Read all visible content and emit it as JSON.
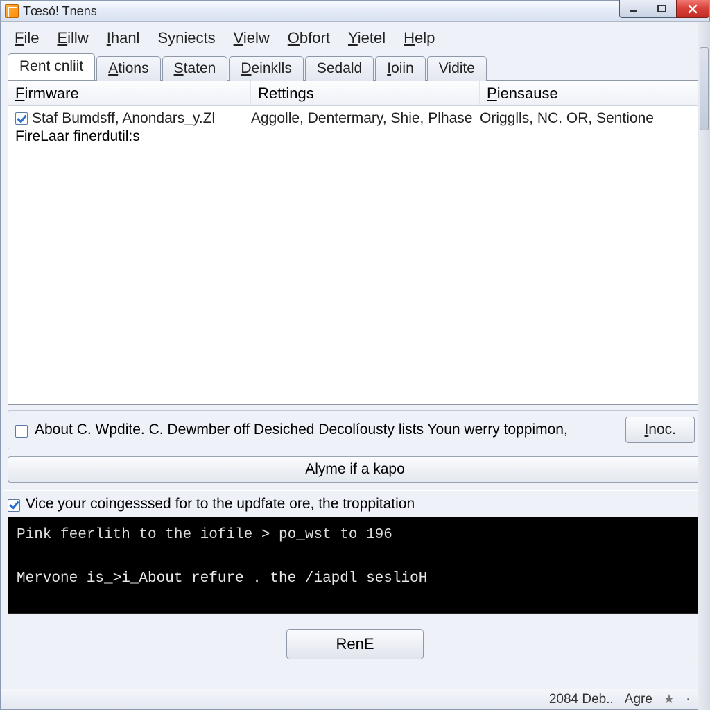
{
  "window": {
    "title": "Tœsó! Tnens"
  },
  "menu": {
    "items": [
      {
        "label": "File",
        "mn": "F",
        "rest": "ile"
      },
      {
        "label": "Eillw",
        "mn": "E",
        "rest": "illw"
      },
      {
        "label": "Ihanl",
        "mn": "I",
        "rest": "hanl"
      },
      {
        "label": "Syniects",
        "mn": "",
        "rest": "Syniects"
      },
      {
        "label": "Vielw",
        "mn": "V",
        "rest": "ielw"
      },
      {
        "label": "Obfort",
        "mn": "O",
        "rest": "bfort"
      },
      {
        "label": "Yietel",
        "mn": "Y",
        "rest": "ietel"
      },
      {
        "label": "Help",
        "mn": "H",
        "rest": "elp"
      }
    ]
  },
  "tabs": [
    {
      "label": "Rent cnliit",
      "active": true
    },
    {
      "label": "Ations",
      "mn": "A",
      "rest": "tions"
    },
    {
      "label": "Staten",
      "mn": "S",
      "rest": "taten"
    },
    {
      "label": "Deinklls",
      "mn": "D",
      "rest": "einklls"
    },
    {
      "label": "Sedald"
    },
    {
      "label": "Ioiin",
      "mn": "I",
      "rest": "oiin"
    },
    {
      "label": "Vidite"
    }
  ],
  "columns": {
    "c1": {
      "mn": "F",
      "rest": "irmware"
    },
    "c2": {
      "label": "Rettings"
    },
    "c3": {
      "mn": "P",
      "rest": "iensause"
    }
  },
  "row": {
    "c1": "Staf Bumdsff, Anondars_y.Zl",
    "c2": "Aggolle, Dentermary, Shie, Plhase",
    "c3_mn": "O",
    "c3_rest": "rigglls, NC. OR, Sentione"
  },
  "row_extra": "FireLaar finerdutil:s",
  "option": {
    "label": "About C. Wpdite. C.  Dewmber off Desiched Decolíousty lists Youn werry toppimon,",
    "button_mn": "I",
    "button_rest": "noc."
  },
  "wide_button": "Alyme if a kapo",
  "check_line": "Vice your coingesssed for to the updfate ore, the troppitation",
  "console": {
    "line1": "Pink feerlith to the iofile > po_wst to 196",
    "line2": "Mervone is_>i_About refure . the /iapdl seslioH"
  },
  "bottom_button": "RenE",
  "statusbar": {
    "left": "2084 Deb..",
    "right": "Agre"
  }
}
